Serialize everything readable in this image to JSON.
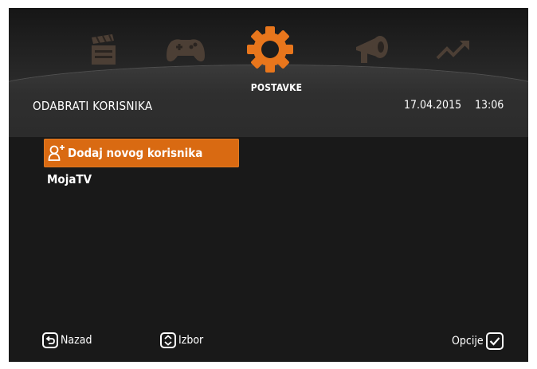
{
  "header": {
    "section_label": "POSTAVKE",
    "page_title": "ODABRATI KORISNIKA",
    "date": "17.04.2015",
    "time": "13:06"
  },
  "menu_icons": [
    {
      "name": "clapperboard-icon",
      "active": false
    },
    {
      "name": "gamepad-icon",
      "active": false
    },
    {
      "name": "gear-icon",
      "active": true
    },
    {
      "name": "megaphone-icon",
      "active": false
    },
    {
      "name": "trend-chart-icon",
      "active": false
    }
  ],
  "users": {
    "items": [
      {
        "label": "Dodaj novog korisnika",
        "icon": "add-user-icon",
        "selected": true
      },
      {
        "label": "MojaTV",
        "selected": false
      }
    ]
  },
  "footer": {
    "back_label": "Nazad",
    "select_label": "Izbor",
    "options_label": "Opcije"
  },
  "colors": {
    "accent": "#d96a12",
    "background": "#191919",
    "inactive_icon": "#4a3d33"
  }
}
